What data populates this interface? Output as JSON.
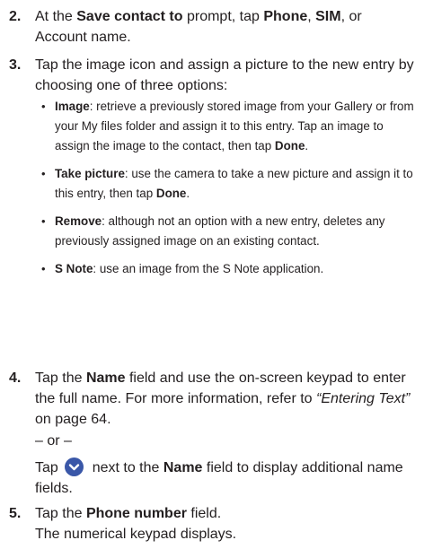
{
  "steps": [
    {
      "num": "2.",
      "t1": "At the ",
      "b1": "Save contact to",
      "t2": " prompt, tap ",
      "b2": "Phone",
      "t3": ", ",
      "b3": "SIM",
      "t4": ", or Account name."
    },
    {
      "num": "3.",
      "text": "Tap the image icon and assign a picture to the new entry by choosing one of three options:",
      "bullets": [
        {
          "b": "Image",
          "t1": ": retrieve a previously stored image from your Gallery or from your My files folder and assign it to this entry. Tap an image to assign the image to the contact, then tap ",
          "b2": "Done",
          "t2": "."
        },
        {
          "b": "Take picture",
          "t1": ": use the camera to take a new picture and assign it to this entry, then tap ",
          "b2": "Done",
          "t2": "."
        },
        {
          "b": "Remove",
          "t1": ": although not an option with a new entry, deletes any previously assigned image on an existing contact.",
          "b2": "",
          "t2": ""
        },
        {
          "b": "S Note",
          "t1": ": use an image from the S Note application.",
          "b2": "",
          "t2": ""
        }
      ]
    },
    {
      "num": "4.",
      "t1": "Tap the ",
      "b1": "Name",
      "t2": " field and use the on-screen keypad to enter the full name. For more information, refer to ",
      "i1": "“Entering Text”",
      "t3": " on page 64.",
      "or": "– or –",
      "t4": "Tap ",
      "t5": " next to the ",
      "b2": "Name",
      "t6": " field to display additional name fields."
    },
    {
      "num": "5.",
      "t1": "Tap the ",
      "b1": "Phone number",
      "t2": " field.",
      "t3": "The numerical keypad displays."
    }
  ],
  "icons": {
    "expand": "chevron-down-icon",
    "expand_color": "#3a57a8"
  }
}
